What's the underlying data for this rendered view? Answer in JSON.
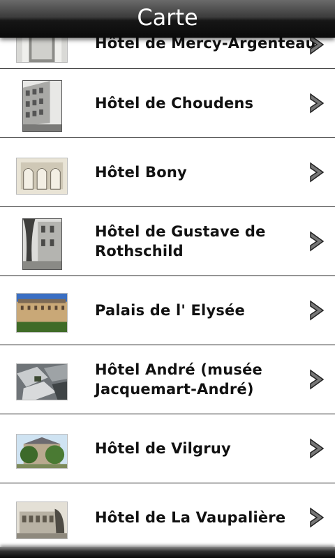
{
  "title_bar": {
    "title": "Carte"
  },
  "items": [
    {
      "label": "Hôtel de Mercy-Argenteau",
      "thumb": "building-portico-photo"
    },
    {
      "label": "Hôtel de Choudens",
      "thumb": "street-facade-photo"
    },
    {
      "label": "Hôtel Bony",
      "thumb": "courtyard-arcade-engraving"
    },
    {
      "label": "Hôtel de Gustave de Rothschild",
      "thumb": "garden-facade-photo"
    },
    {
      "label": "Palais de l' Elysée",
      "thumb": "palace-lawn-photo"
    },
    {
      "label": "Hôtel André (musée Jacquemart-André)",
      "thumb": "aerial-rooftops-photo"
    },
    {
      "label": "Hôtel de Vilgruy",
      "thumb": "trees-facade-photo"
    },
    {
      "label": "Hôtel de La Vaupalière",
      "thumb": "old-postcard-facade"
    }
  ],
  "colors": {
    "title_bar_bg": "#1a1a1a",
    "title_text": "#ffffff",
    "row_bg": "#ffffff",
    "divider": "#222222",
    "label_text": "#111111"
  },
  "icons": {
    "row_chevron": "chevron-right-icon"
  }
}
